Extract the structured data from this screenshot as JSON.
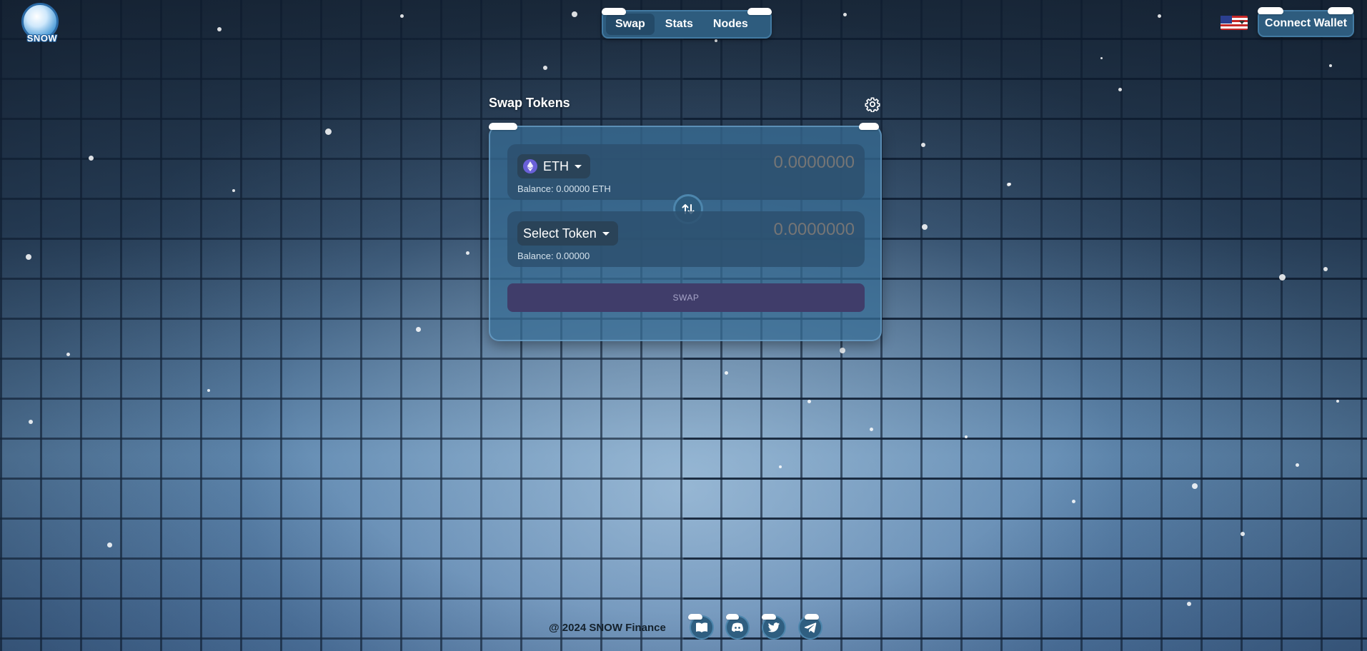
{
  "app": {
    "logo_text": "SNOW",
    "nav": {
      "tabs": [
        "Swap",
        "Stats",
        "Nodes"
      ],
      "active": "Swap"
    },
    "language_flag": "us-flag-icon",
    "connect_wallet_label": "Connect Wallet"
  },
  "swap": {
    "title": "Swap Tokens",
    "from": {
      "token": "ETH",
      "amount_placeholder": "0.0000000",
      "balance": "Balance: 0.00000 ETH"
    },
    "to": {
      "token": "Select Token",
      "amount_placeholder": "0.0000000",
      "balance": "Balance: 0.00000"
    },
    "submit_label": "SWAP"
  },
  "footer": {
    "copyright": "@ 2024 SNOW Finance",
    "links": [
      "docs-icon",
      "discord-icon",
      "twitter-icon",
      "telegram-icon"
    ]
  },
  "colors": {
    "panel": "#376e96",
    "nav": "#2e5c7e",
    "swap_button": "#403d6a",
    "eth": "#6a60d8"
  }
}
